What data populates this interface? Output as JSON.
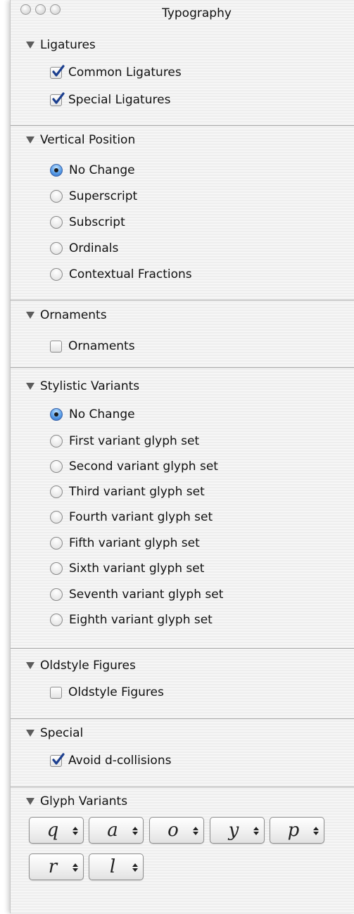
{
  "window": {
    "title": "Typography"
  },
  "sections": {
    "ligatures": {
      "title": "Ligatures",
      "options": [
        {
          "label": "Common Ligatures",
          "checked": true
        },
        {
          "label": "Special Ligatures",
          "checked": true
        }
      ]
    },
    "vertical_position": {
      "title": "Vertical Position",
      "options": [
        {
          "label": "No Change",
          "selected": true
        },
        {
          "label": "Superscript",
          "selected": false
        },
        {
          "label": "Subscript",
          "selected": false
        },
        {
          "label": "Ordinals",
          "selected": false
        },
        {
          "label": "Contextual Fractions",
          "selected": false
        }
      ]
    },
    "ornaments": {
      "title": "Ornaments",
      "options": [
        {
          "label": "Ornaments",
          "checked": false
        }
      ]
    },
    "stylistic_variants": {
      "title": "Stylistic Variants",
      "options": [
        {
          "label": "No Change",
          "selected": true
        },
        {
          "label": "First variant glyph set",
          "selected": false
        },
        {
          "label": "Second variant glyph set",
          "selected": false
        },
        {
          "label": "Third variant glyph set",
          "selected": false
        },
        {
          "label": "Fourth variant glyph set",
          "selected": false
        },
        {
          "label": "Fifth variant glyph set",
          "selected": false
        },
        {
          "label": "Sixth variant glyph set",
          "selected": false
        },
        {
          "label": "Seventh variant glyph set",
          "selected": false
        },
        {
          "label": "Eighth variant glyph set",
          "selected": false
        }
      ]
    },
    "oldstyle_figures": {
      "title": "Oldstyle Figures",
      "options": [
        {
          "label": "Oldstyle Figures",
          "checked": false
        }
      ]
    },
    "special": {
      "title": "Special",
      "options": [
        {
          "label": "Avoid d-collisions",
          "checked": true
        }
      ]
    },
    "glyph_variants": {
      "title": "Glyph Variants",
      "glyphs": [
        "q",
        "a",
        "o",
        "y",
        "p",
        "r",
        "l"
      ]
    }
  },
  "colors": {
    "radio_selected": "#3a7bd5",
    "checkmark": "#1c3f8f"
  }
}
